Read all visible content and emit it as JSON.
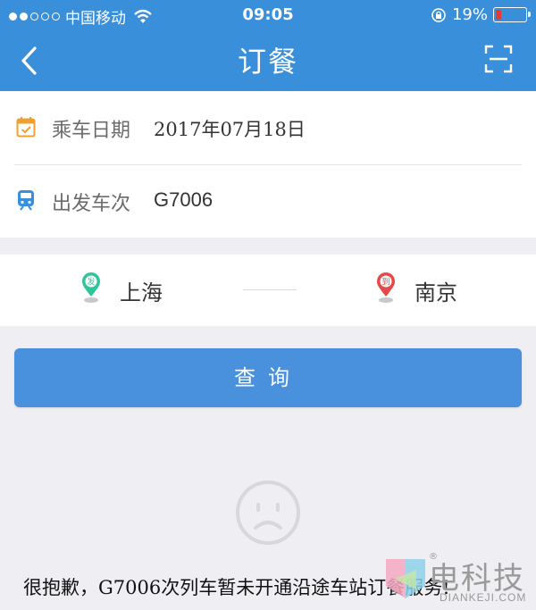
{
  "status_bar": {
    "carrier": "中国移动",
    "time": "09:05",
    "battery": "19%",
    "battery_level": 0.19,
    "icons": [
      "signal-dots-icon",
      "wifi-icon",
      "orientation-lock-icon",
      "battery-icon"
    ]
  },
  "nav": {
    "title": "订餐",
    "back_icon": "chevron-left-icon",
    "scan_icon": "scan-icon"
  },
  "trip": {
    "date_label": "乘车日期",
    "date_value": "2017年07月18日",
    "train_label": "出发车次",
    "train_value": "G7006"
  },
  "stations": {
    "from_pin_text": "发",
    "from": "上海",
    "to_pin_text": "到",
    "to": "南京"
  },
  "query_button": "查询",
  "message": "很抱歉，G7006次列车暂未开通沿途车站订餐服务!",
  "watermark": {
    "text": "电科技",
    "sub": "DIANKEJI.COM",
    "reg": "®"
  },
  "colors": {
    "header_blue": "#3a8fdb",
    "button_blue": "#4990dd",
    "calendar_orange": "#f0a030",
    "train_blue": "#3a8fdb",
    "pin_green": "#2fc59a",
    "pin_red": "#e5494a",
    "battery_red": "#e23a35",
    "background": "#eeeef3"
  }
}
